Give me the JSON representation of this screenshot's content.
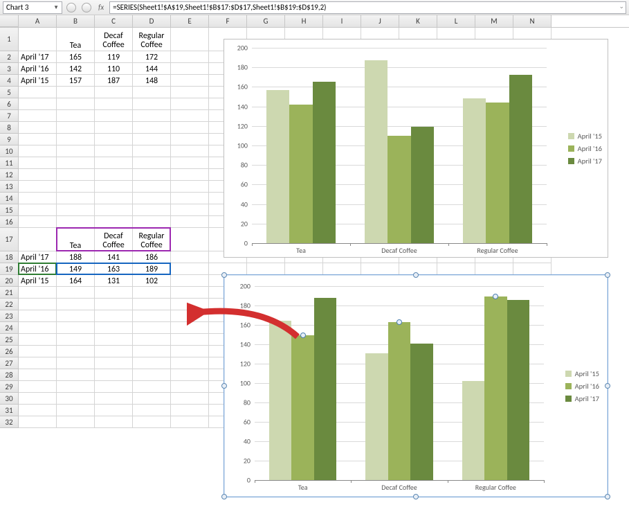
{
  "name_box": "Chart 3",
  "formula": "=SERIES(Sheet1!$A$19,Sheet1!$B$17:$D$17,Sheet1!$B$19:$D$19,2)",
  "cols": [
    "A",
    "B",
    "C",
    "D",
    "E",
    "F",
    "G",
    "H",
    "I",
    "J",
    "K",
    "L",
    "M",
    "N"
  ],
  "rows": [
    "1",
    "2",
    "3",
    "4",
    "5",
    "6",
    "7",
    "8",
    "9",
    "10",
    "11",
    "12",
    "13",
    "14",
    "15",
    "16",
    "17",
    "18",
    "19",
    "20",
    "21",
    "22",
    "23",
    "24",
    "25",
    "26",
    "27",
    "28",
    "29",
    "30",
    "31",
    "32"
  ],
  "table1": {
    "headers": [
      "Tea",
      "Decaf Coffee",
      "Regular Coffee"
    ],
    "rows": [
      {
        "label": "April '17",
        "vals": [
          "165",
          "119",
          "172"
        ]
      },
      {
        "label": "April '16",
        "vals": [
          "142",
          "110",
          "144"
        ]
      },
      {
        "label": "April '15",
        "vals": [
          "157",
          "187",
          "148"
        ]
      }
    ]
  },
  "table2": {
    "headers": [
      "Tea",
      "Decaf Coffee",
      "Regular Coffee"
    ],
    "rows": [
      {
        "label": "April '17",
        "vals": [
          "188",
          "141",
          "186"
        ]
      },
      {
        "label": "April '16",
        "vals": [
          "149",
          "163",
          "189"
        ]
      },
      {
        "label": "April '15",
        "vals": [
          "164",
          "131",
          "102"
        ]
      }
    ]
  },
  "chart_data": [
    {
      "type": "bar",
      "categories": [
        "Tea",
        "Decaf Coffee",
        "Regular Coffee"
      ],
      "series": [
        {
          "name": "April '15",
          "values": [
            157,
            187,
            148
          ]
        },
        {
          "name": "April '16",
          "values": [
            142,
            110,
            144
          ]
        },
        {
          "name": "April '17",
          "values": [
            165,
            119,
            172
          ]
        }
      ],
      "ylim": [
        0,
        200
      ],
      "ytick": 20,
      "legend_pos": "right",
      "colors": [
        "#cdd8b0",
        "#9bb35a",
        "#6a8a3f"
      ]
    },
    {
      "type": "bar",
      "categories": [
        "Tea",
        "Decaf Coffee",
        "Regular Coffee"
      ],
      "series": [
        {
          "name": "April '15",
          "values": [
            164,
            131,
            102
          ]
        },
        {
          "name": "April '16",
          "values": [
            149,
            163,
            189
          ]
        },
        {
          "name": "April '17",
          "values": [
            188,
            141,
            186
          ]
        }
      ],
      "ylim": [
        0,
        200
      ],
      "ytick": 20,
      "legend_pos": "right",
      "colors": [
        "#cdd8b0",
        "#9bb35a",
        "#6a8a3f"
      ],
      "selected_series": 1
    }
  ]
}
